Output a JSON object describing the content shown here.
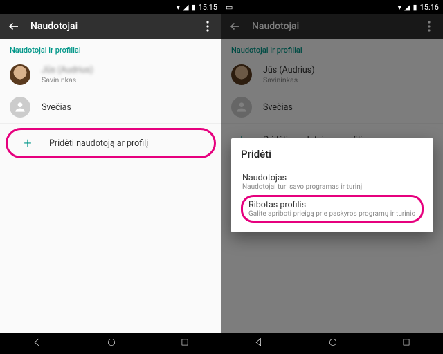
{
  "left": {
    "status": {
      "time": "15:15"
    },
    "appbar": {
      "title": "Naudotojai"
    },
    "section_label": "Naudotojai ir profiliai",
    "owner_row": {
      "name_blurred": "Jūs (Audrius)",
      "subtitle": "Savininkas"
    },
    "guest_row": {
      "label": "Svečias"
    },
    "add_row": {
      "label": "Pridėti naudotoją ar profilį"
    }
  },
  "right": {
    "status": {
      "time": "15:16"
    },
    "appbar": {
      "title": "Naudotojai"
    },
    "section_label": "Naudotojai ir profiliai",
    "owner_row": {
      "name": "Jūs (Audrius)",
      "subtitle": "Savininkas"
    },
    "guest_row": {
      "label": "Svečias"
    },
    "add_row": {
      "label": "Pridėti naudotoją ar profilį"
    },
    "dialog": {
      "title": "Pridėti",
      "option1": {
        "title": "Naudotojas",
        "subtitle": "Naudotojai turi savo programas ir turinį"
      },
      "option2": {
        "title": "Ribotas profilis",
        "subtitle": "Galite apriboti prieigą prie paskyros programų ir turinio"
      }
    }
  },
  "colors": {
    "accent": "#009688",
    "highlight": "#e6007e"
  }
}
